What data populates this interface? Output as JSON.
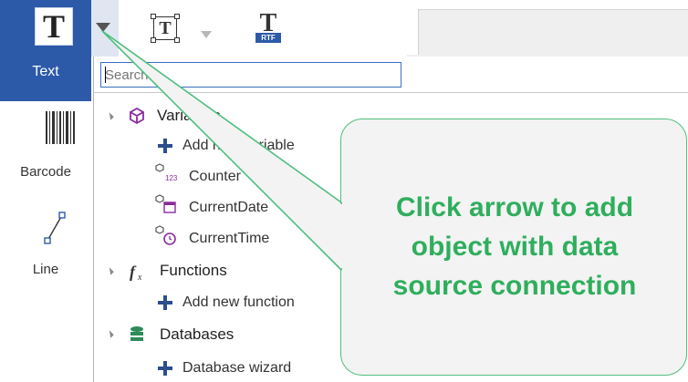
{
  "toolbox": {
    "text_label": "Text",
    "text_icon_glyph": "T",
    "barcode_label": "Barcode",
    "line_label": "Line"
  },
  "toolbar": {
    "frame_icon_glyph": "T",
    "rtf_icon_glyph": "T",
    "rtf_tag": "RTF"
  },
  "search": {
    "placeholder": "Search..."
  },
  "tree": {
    "variables": {
      "label": "Variables",
      "items": [
        "Add new variable",
        "Counter",
        "CurrentDate",
        "CurrentTime"
      ]
    },
    "functions": {
      "label": "Functions",
      "items": [
        "Add new function"
      ]
    },
    "databases": {
      "label": "Databases",
      "items": [
        "Database wizard"
      ]
    }
  },
  "callout": {
    "lines": [
      "Click arrow to add",
      "object with data",
      "source connection"
    ]
  },
  "colors": {
    "accent_blue": "#2d5aa8",
    "callout_green": "#2fae5d",
    "callout_border": "#4fbf7f",
    "variables_purple": "#8a2a9e",
    "databases_green": "#2e8b57"
  }
}
